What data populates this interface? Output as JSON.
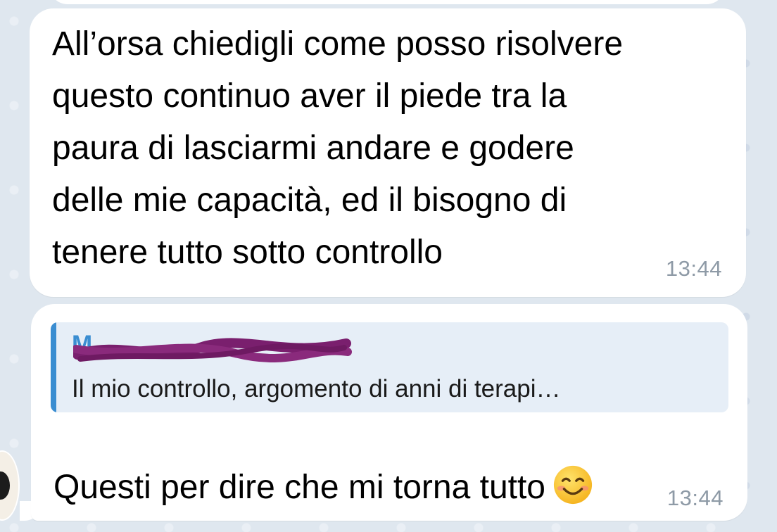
{
  "colors": {
    "wallpaper": "#dfe7ef",
    "bubble": "#ffffff",
    "reply_accent": "#3a8dd1",
    "reply_background": "#e6eef7",
    "timestamp": "#8e9aa6",
    "scribble": "#7a1f6e"
  },
  "messages": [
    {
      "text": "All’orsa chiedigli come posso risolvere\nquesto continuo aver il piede tra la\npaura di lasciarmi andare e godere\ndelle mie capacità, ed il bisogno di\ntenere tutto sotto controllo",
      "time": "13:44"
    },
    {
      "reply": {
        "sender": "M",
        "text": "Il mio controllo, argomento di anni di terapi…"
      },
      "text": "Questi per dire che mi torna tutto",
      "emoji": "smiling-face-emoji",
      "time": "13:44"
    }
  ],
  "avatar": {
    "icon": "sender-avatar"
  }
}
